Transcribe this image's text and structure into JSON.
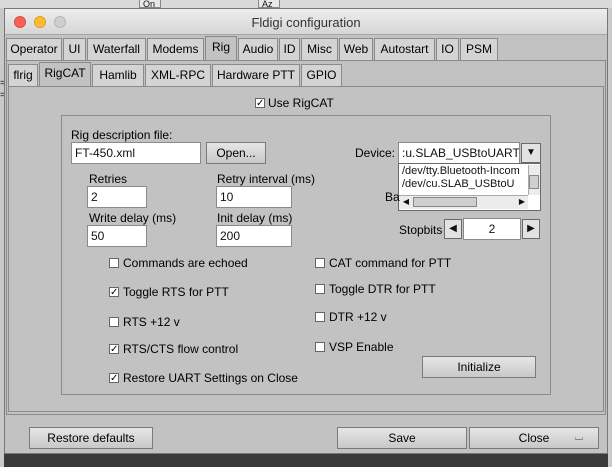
{
  "window": {
    "title": "Fldigi configuration"
  },
  "background": {
    "btn1": "On",
    "btn2": "Az",
    "side_text": "="
  },
  "top_tabs": [
    {
      "label": "Operator"
    },
    {
      "label": "UI"
    },
    {
      "label": "Waterfall"
    },
    {
      "label": "Modems"
    },
    {
      "label": "Rig"
    },
    {
      "label": "Audio"
    },
    {
      "label": "ID"
    },
    {
      "label": "Misc"
    },
    {
      "label": "Web"
    },
    {
      "label": "Autostart"
    },
    {
      "label": "IO"
    },
    {
      "label": "PSM"
    }
  ],
  "sub_tabs": [
    {
      "label": "flrig"
    },
    {
      "label": "RigCAT"
    },
    {
      "label": "Hamlib"
    },
    {
      "label": "XML-RPC"
    },
    {
      "label": "Hardware PTT"
    },
    {
      "label": "GPIO"
    }
  ],
  "use_rigcat": {
    "label": "Use RigCAT",
    "checked": true
  },
  "rig_desc": {
    "label": "Rig description file:",
    "value": "FT-450.xml",
    "open_label": "Open..."
  },
  "device": {
    "label": "Device:",
    "value": ":u.SLAB_USBtoUART",
    "options": [
      "/dev/tty.Bluetooth-Incom",
      "/dev/cu.SLAB_USBtoU"
    ]
  },
  "baud_label_partial": "Ba",
  "retries": {
    "label": "Retries",
    "value": "2"
  },
  "retry_interval": {
    "label": "Retry interval (ms)",
    "value": "10"
  },
  "write_delay": {
    "label": "Write delay (ms)",
    "value": "50"
  },
  "init_delay": {
    "label": "Init delay (ms)",
    "value": "200"
  },
  "stopbits": {
    "label": "Stopbits",
    "value": "2"
  },
  "checks_left": [
    {
      "label": "Commands are echoed",
      "checked": false
    },
    {
      "label": "Toggle RTS for PTT",
      "checked": true
    },
    {
      "label": "RTS +12 v",
      "checked": false
    },
    {
      "label": "RTS/CTS flow control",
      "checked": true
    },
    {
      "label": "Restore UART Settings on Close",
      "checked": true
    }
  ],
  "checks_right": [
    {
      "label": "CAT command for PTT",
      "checked": false
    },
    {
      "label": "Toggle DTR for PTT",
      "checked": false
    },
    {
      "label": "DTR +12 v",
      "checked": false
    },
    {
      "label": "VSP Enable",
      "checked": false
    }
  ],
  "initialize_label": "Initialize",
  "footer": {
    "restore_label": "Restore defaults",
    "save_label": "Save",
    "close_label": "Close"
  }
}
